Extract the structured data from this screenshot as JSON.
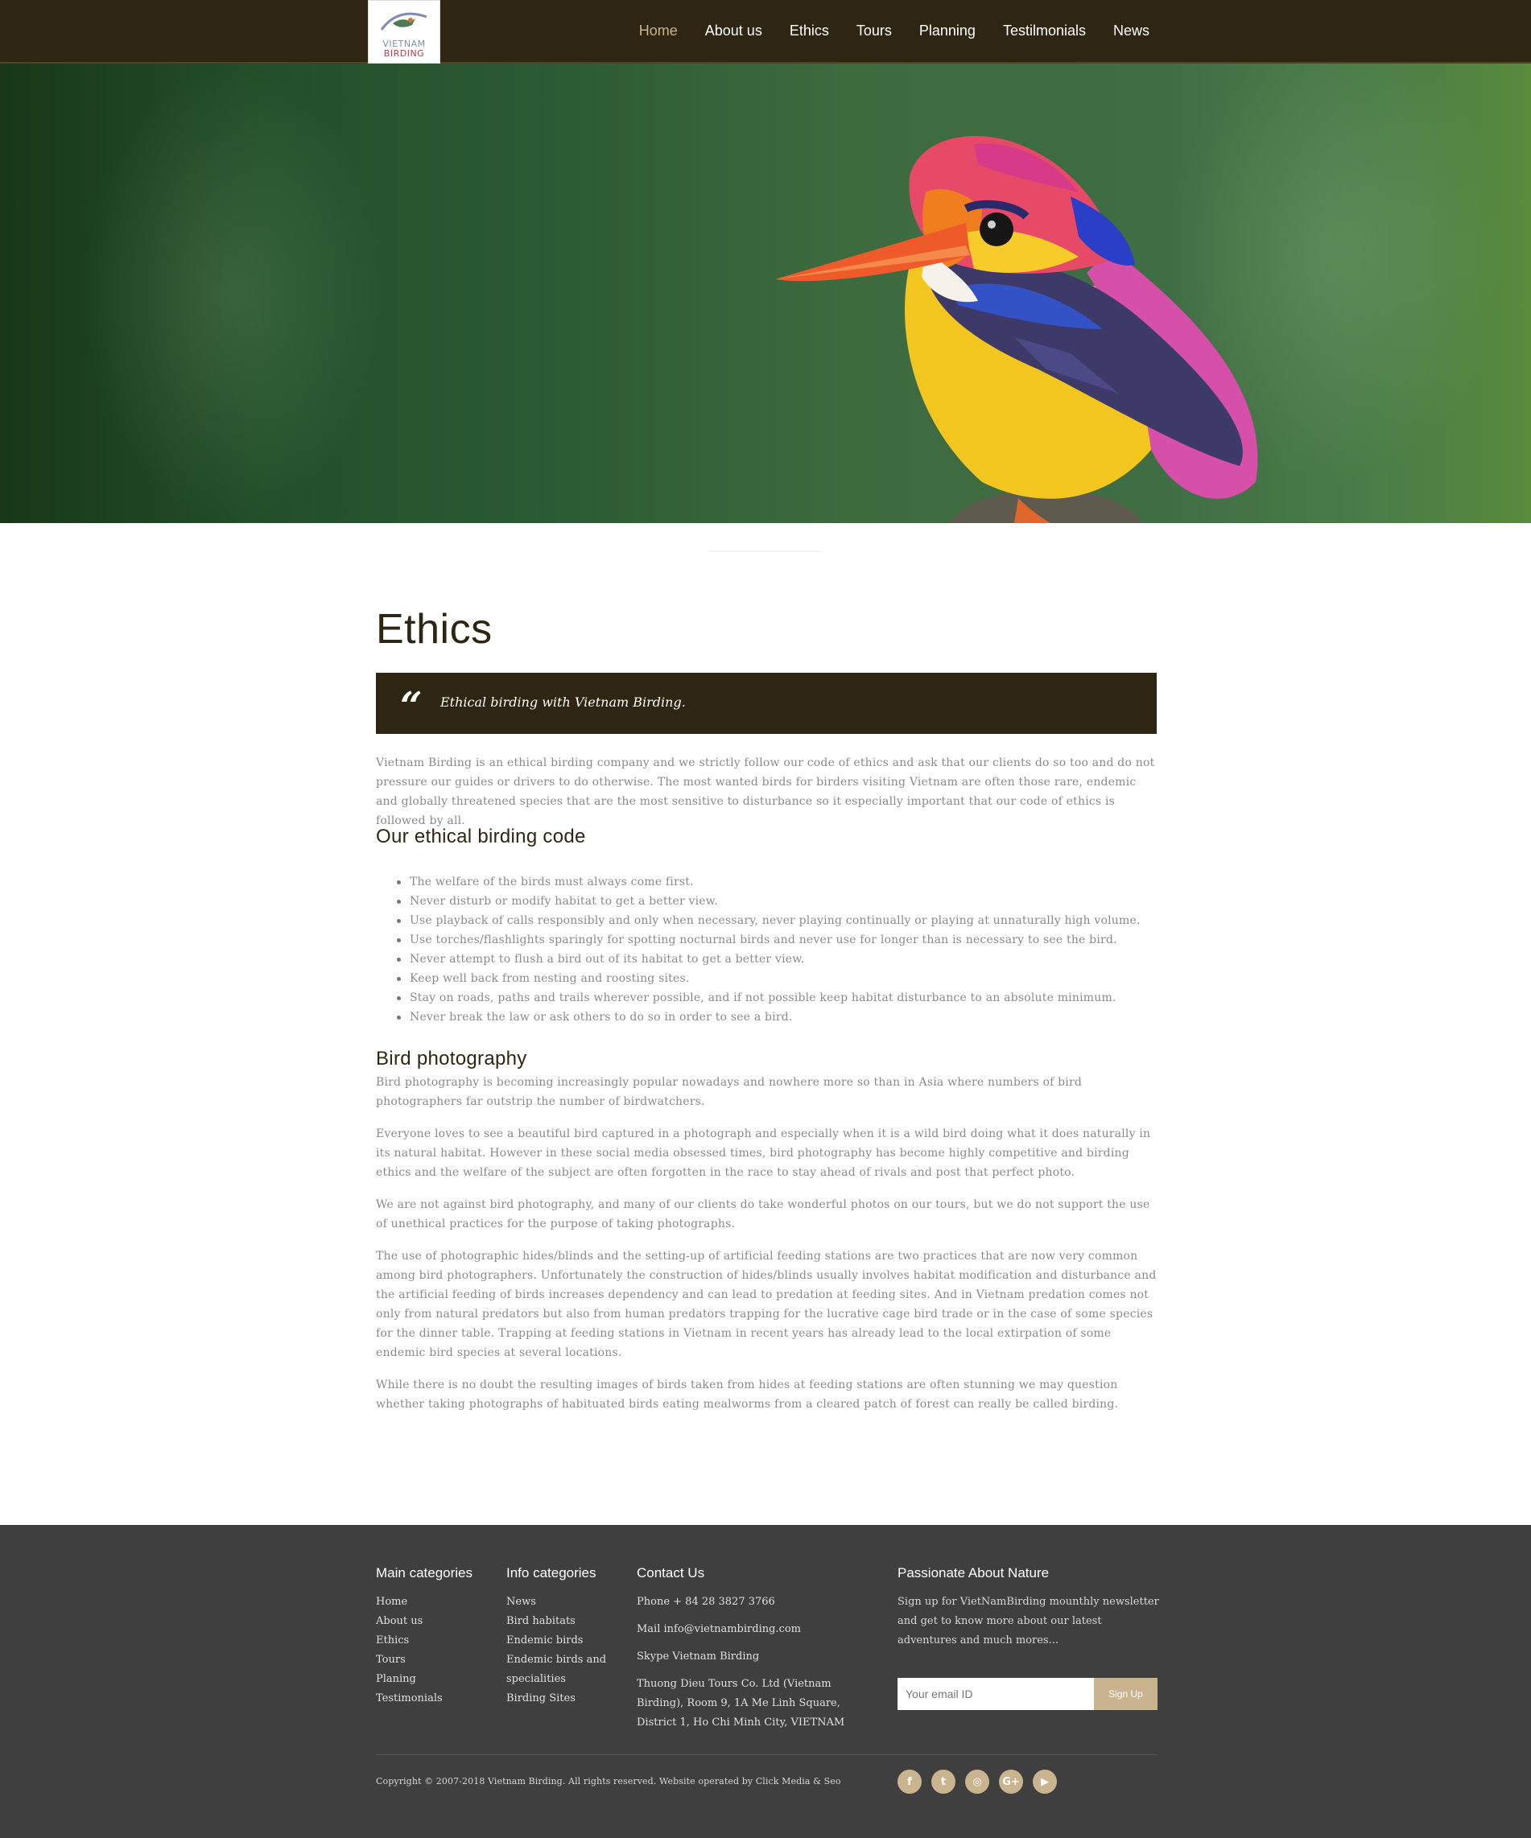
{
  "header": {
    "logo": {
      "line1": "VIETNAM",
      "line2": "BIRDING"
    },
    "nav": [
      "Home",
      "About us",
      "Ethics",
      "Tours",
      "Planning",
      "Testilmonials",
      "News"
    ],
    "active_nav": "Home"
  },
  "page": {
    "title": "Ethics",
    "quote_mark": "“",
    "quote": "Ethical birding with Vietnam Birding.",
    "intro": "Vietnam Birding is an ethical birding company and we strictly follow our code of ethics and ask that our clients do so too and do not pressure our guides or drivers to do otherwise. The most wanted birds for birders visiting Vietnam are often those rare, endemic and globally threatened species that are the most sensitive to disturbance so it especially important that our code of ethics is followed by all.",
    "code_heading": "Our ethical birding code",
    "code_items": [
      "The welfare of the birds must always come first.",
      "Never disturb or modify habitat to get a better view.",
      "Use playback of calls responsibly and only when necessary, never playing continually or playing at unnaturally high volume.",
      "Use torches/flashlights sparingly for spotting nocturnal birds and never use for longer than is necessary to see the bird.",
      "Never attempt to flush a bird out of its habitat to get a better view.",
      "Keep well back from nesting and roosting sites.",
      "Stay on roads, paths and trails wherever possible, and if not possible keep habitat disturbance to an absolute minimum.",
      "Never break the law or ask others to do so in order to see a bird."
    ],
    "photo_heading": "Bird photography",
    "photo_paragraphs": [
      "Bird photography is becoming increasingly popular nowadays and nowhere more so than in Asia where numbers of bird photographers far outstrip the number of birdwatchers.",
      "Everyone loves to see a beautiful bird captured in a photograph and especially when it is a wild bird doing what it does naturally in its natural habitat. However in these social media obsessed times, bird photography has become highly competitive and birding ethics and the welfare of the subject are often forgotten in the race to stay ahead of rivals and post that perfect photo.",
      "We are not against bird photography, and many of our clients do take wonderful photos on our tours, but we do not support the use of unethical practices for the purpose of taking photographs.",
      "The use of photographic hides/blinds and the setting-up of artificial feeding stations are two practices that are now very common among bird photographers. Unfortunately the construction of hides/blinds usually involves habitat modification and disturbance and the artificial feeding of birds increases dependency and can lead to predation at feeding sites. And in Vietnam predation comes not only from natural predators but also from human predators trapping for the lucrative cage bird trade or in the case of some species for the dinner table. Trapping at feeding stations in Vietnam in recent years has already lead to the local extirpation of some endemic bird species at several locations.",
      "While there is no doubt the resulting images of birds taken from hides at feeding stations are often stunning we may question whether taking photographs of habituated birds eating mealworms from a cleared patch of forest can really be called birding."
    ]
  },
  "footer": {
    "main_heading": "Main categories",
    "main_links": [
      "Home",
      "About us",
      "Ethics",
      "Tours",
      "Planing",
      "Testimonials"
    ],
    "info_heading": "Info categories",
    "info_links": [
      "News",
      "Bird habitats",
      "Endemic birds",
      "Endemic birds and specialities",
      "Birding Sites"
    ],
    "contact_heading": "Contact Us",
    "phone": "Phone + 84 28 3827 3766",
    "mail": "Mail info@vietnambirding.com",
    "skype": "Skype Vietnam Birding",
    "address": "Thuong Dieu Tours Co. Ltd (Vietnam Birding), Room 9, 1A Me Linh Square, District 1, Ho Chi Minh City, VIETNAM",
    "newsletter_heading": "Passionate About Nature",
    "newsletter_text": "Sign up for VietNamBirding mounthly newsletter and get to know more about our latest adventures and much mores...",
    "email_placeholder": "Your email ID",
    "signup_label": "Sign Up",
    "copyright": "Copyright © 2007-2018 Vietnam Birding. All rights reserved. Website operated by Click Media & Seo",
    "social": [
      {
        "icon": "facebook-icon",
        "glyph": "f"
      },
      {
        "icon": "twitter-icon",
        "glyph": "t"
      },
      {
        "icon": "instagram-icon",
        "glyph": "◎"
      },
      {
        "icon": "google-plus-icon",
        "glyph": "G+"
      },
      {
        "icon": "youtube-icon",
        "glyph": "▶"
      }
    ]
  },
  "colors": {
    "header_bg": "#2e2613",
    "accent": "#c9b48f",
    "footer_bg": "#3f3f3f",
    "text": "#8a8a8a"
  }
}
